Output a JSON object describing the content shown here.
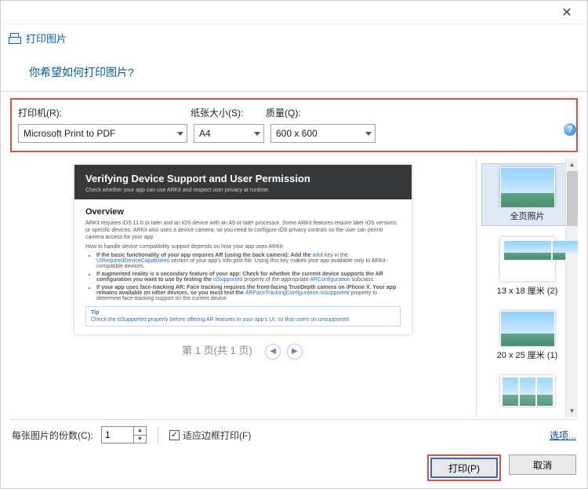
{
  "titlebar": {
    "close_glyph": "✕"
  },
  "window_title": "打印图片",
  "header_prompt": "你希望如何打印图片?",
  "labels": {
    "printer": "打印机(R):",
    "paper_size": "纸张大小(S):",
    "quality": "质量(Q):"
  },
  "selections": {
    "printer": "Microsoft Print to PDF",
    "paper_size": "A4",
    "quality": "600 x 600"
  },
  "help_glyph": "?",
  "preview": {
    "doc_title": "Verifying Device Support and User Permission",
    "doc_subtitle": "Check whether your app can use ARKit and respect user privacy at runtime.",
    "overview_heading": "Overview",
    "overview_p1": "ARKit requires iOS 11.0 or later and an iOS device with an A9 or later processor. Some ARKit features require later iOS versions or specific devices. ARKit also uses a device camera, so you need to configure iOS privacy controls so the user can permit camera access for your app.",
    "overview_p2": "How to handle device compatibility support depends on how your app uses ARKit:",
    "li1_a": "If the basic functionality of your app requires AR (using the back camera): Add the ",
    "li1_link1": "arkit",
    "li1_b": " key in the ",
    "li1_link2": "UIRequiredDeviceCapabilities",
    "li1_c": " section of your app's Info.plist file. Using this key makes your app available only to ARKit-compatible devices.",
    "li2_a": "If augmented reality is a secondary feature of your app: Check for whether the current device supports the AR configuration you want to use by testing the ",
    "li2_link1": "isSupported",
    "li2_b": " property of the appropriate ",
    "li2_link2": "ARConfiguration",
    "li2_c": " subclass.",
    "li3_a": "If your app uses face-tracking AR: Face tracking requires the front-facing TrueDepth camera on iPhone X. Your app remains available on other devices, so you must test the ",
    "li3_link1": "ARFaceTrackingConfiguration.isSupported",
    "li3_b": " property to determine face-tracking support on the current device.",
    "tip_label": "Tip",
    "tip_text_a": "Check the ",
    "tip_link": "isSupported",
    "tip_text_b": " property before offering AR features in your app's UI, so that users on unsupported"
  },
  "pager": {
    "text": "第 1 页(共 1 页)",
    "prev_glyph": "◀",
    "next_glyph": "▶"
  },
  "layouts": {
    "full": "全页照片",
    "l13x18": "13 x 18 厘米 (2)",
    "l20x25": "20 x 25 厘米 (1)"
  },
  "footer": {
    "copies_label": "每张图片的份数(C):",
    "copies_value": "1",
    "fit_frame_label": "适应边框打印(F)",
    "options_link": "选项..."
  },
  "buttons": {
    "print": "打印(P)",
    "cancel": "取消"
  }
}
